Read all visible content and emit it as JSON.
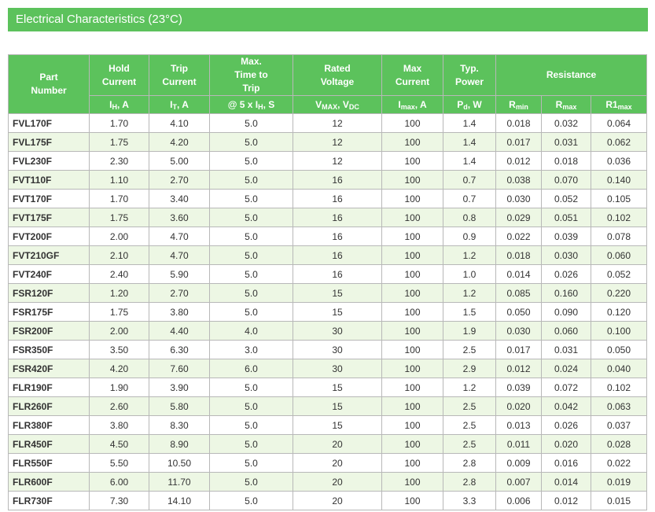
{
  "title": "Electrical Characteristics (23°C)",
  "headers": {
    "part_number": "Part Number",
    "hold_current": "Hold Current",
    "trip_current": "Trip Current",
    "max_time": "Max. Time to Trip",
    "rated_voltage": "Rated Voltage",
    "max_current": "Max Current",
    "typ_power": "Typ. Power",
    "resistance": "Resistance"
  },
  "units": {
    "ih": {
      "main": "I",
      "sub": "H",
      "tail": ", A"
    },
    "it": {
      "main": "I",
      "sub": "T",
      "tail": ", A"
    },
    "ttt": {
      "pre": "@ 5 x I",
      "sub": "H",
      "tail": ", S"
    },
    "v": {
      "a": "V",
      "asub": "MAX",
      "b": ", V",
      "bsub": "DC"
    },
    "imax": {
      "main": "I",
      "sub": "max",
      "tail": ", A"
    },
    "pd": {
      "main": "P",
      "sub": "d",
      "tail": ", W"
    },
    "rmin": {
      "main": "R",
      "sub": "min"
    },
    "rmax": {
      "main": "R",
      "sub": "max"
    },
    "r1max": {
      "main": "R1",
      "sub": "max"
    }
  },
  "rows": [
    [
      "FVL170F",
      "1.70",
      "4.10",
      "5.0",
      "12",
      "100",
      "1.4",
      "0.018",
      "0.032",
      "0.064"
    ],
    [
      "FVL175F",
      "1.75",
      "4.20",
      "5.0",
      "12",
      "100",
      "1.4",
      "0.017",
      "0.031",
      "0.062"
    ],
    [
      "FVL230F",
      "2.30",
      "5.00",
      "5.0",
      "12",
      "100",
      "1.4",
      "0.012",
      "0.018",
      "0.036"
    ],
    [
      "FVT110F",
      "1.10",
      "2.70",
      "5.0",
      "16",
      "100",
      "0.7",
      "0.038",
      "0.070",
      "0.140"
    ],
    [
      "FVT170F",
      "1.70",
      "3.40",
      "5.0",
      "16",
      "100",
      "0.7",
      "0.030",
      "0.052",
      "0.105"
    ],
    [
      "FVT175F",
      "1.75",
      "3.60",
      "5.0",
      "16",
      "100",
      "0.8",
      "0.029",
      "0.051",
      "0.102"
    ],
    [
      "FVT200F",
      "2.00",
      "4.70",
      "5.0",
      "16",
      "100",
      "0.9",
      "0.022",
      "0.039",
      "0.078"
    ],
    [
      "FVT210GF",
      "2.10",
      "4.70",
      "5.0",
      "16",
      "100",
      "1.2",
      "0.018",
      "0.030",
      "0.060"
    ],
    [
      "FVT240F",
      "2.40",
      "5.90",
      "5.0",
      "16",
      "100",
      "1.0",
      "0.014",
      "0.026",
      "0.052"
    ],
    [
      "FSR120F",
      "1.20",
      "2.70",
      "5.0",
      "15",
      "100",
      "1.2",
      "0.085",
      "0.160",
      "0.220"
    ],
    [
      "FSR175F",
      "1.75",
      "3.80",
      "5.0",
      "15",
      "100",
      "1.5",
      "0.050",
      "0.090",
      "0.120"
    ],
    [
      "FSR200F",
      "2.00",
      "4.40",
      "4.0",
      "30",
      "100",
      "1.9",
      "0.030",
      "0.060",
      "0.100"
    ],
    [
      "FSR350F",
      "3.50",
      "6.30",
      "3.0",
      "30",
      "100",
      "2.5",
      "0.017",
      "0.031",
      "0.050"
    ],
    [
      "FSR420F",
      "4.20",
      "7.60",
      "6.0",
      "30",
      "100",
      "2.9",
      "0.012",
      "0.024",
      "0.040"
    ],
    [
      "FLR190F",
      "1.90",
      "3.90",
      "5.0",
      "15",
      "100",
      "1.2",
      "0.039",
      "0.072",
      "0.102"
    ],
    [
      "FLR260F",
      "2.60",
      "5.80",
      "5.0",
      "15",
      "100",
      "2.5",
      "0.020",
      "0.042",
      "0.063"
    ],
    [
      "FLR380F",
      "3.80",
      "8.30",
      "5.0",
      "15",
      "100",
      "2.5",
      "0.013",
      "0.026",
      "0.037"
    ],
    [
      "FLR450F",
      "4.50",
      "8.90",
      "5.0",
      "20",
      "100",
      "2.5",
      "0.011",
      "0.020",
      "0.028"
    ],
    [
      "FLR550F",
      "5.50",
      "10.50",
      "5.0",
      "20",
      "100",
      "2.8",
      "0.009",
      "0.016",
      "0.022"
    ],
    [
      "FLR600F",
      "6.00",
      "11.70",
      "5.0",
      "20",
      "100",
      "2.8",
      "0.007",
      "0.014",
      "0.019"
    ],
    [
      "FLR730F",
      "7.30",
      "14.10",
      "5.0",
      "20",
      "100",
      "3.3",
      "0.006",
      "0.012",
      "0.015"
    ]
  ],
  "colors": {
    "header_green": "#5cc25c",
    "row_alt": "#edf7e4"
  }
}
